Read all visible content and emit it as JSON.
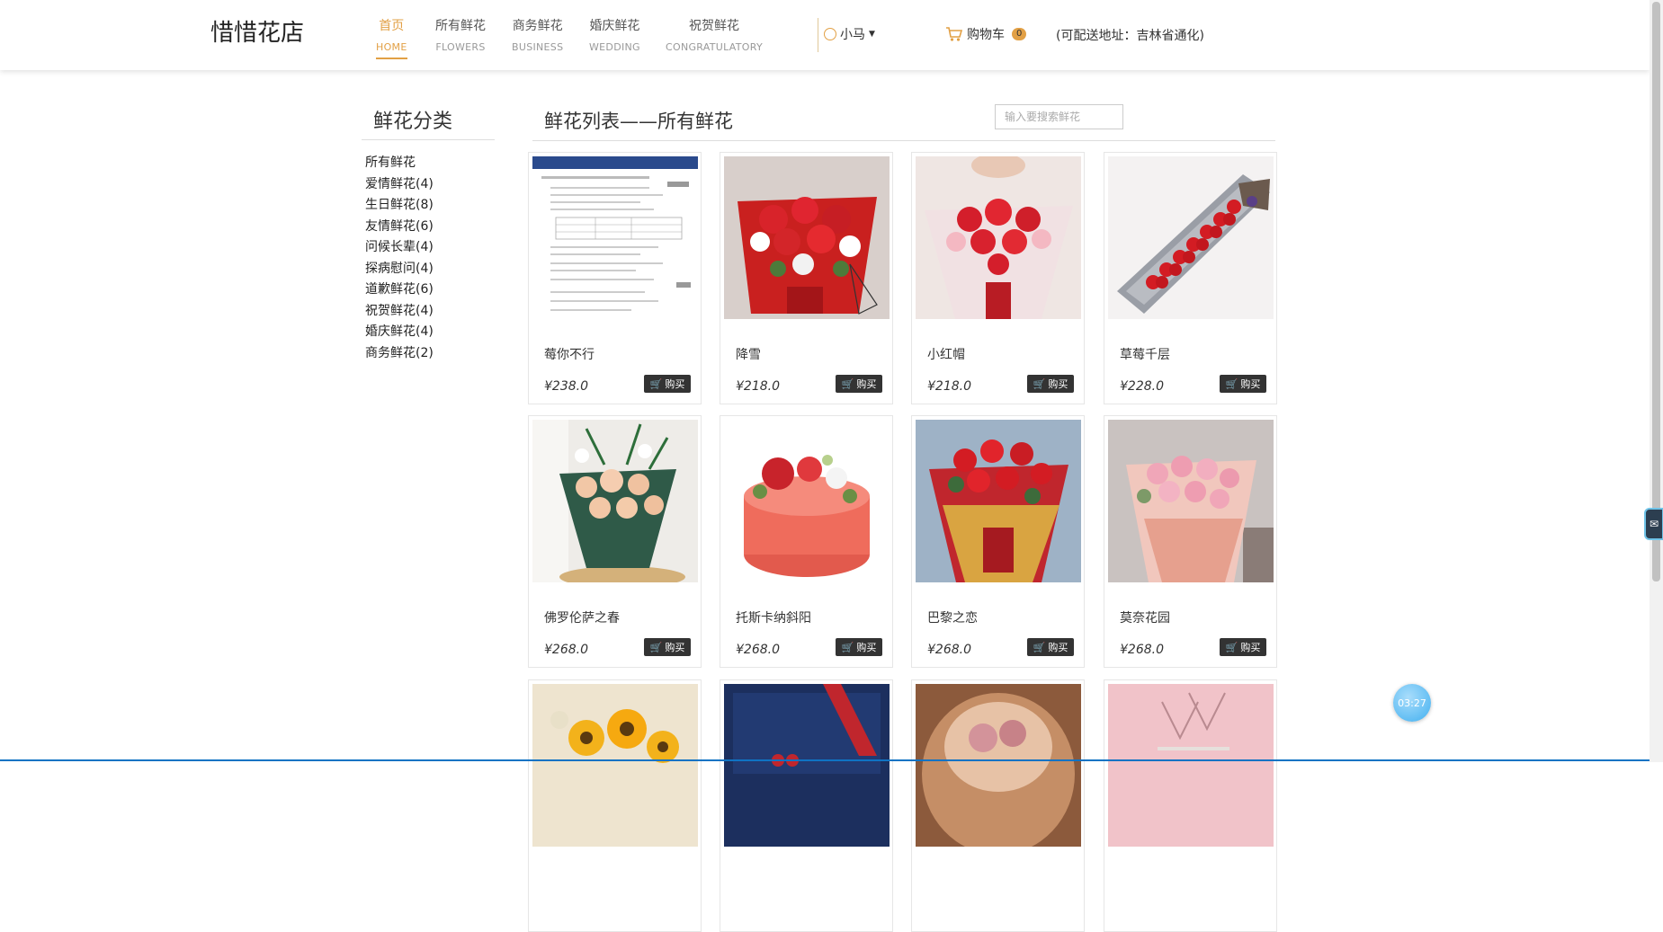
{
  "header": {
    "logo": "惜惜花店",
    "nav": [
      {
        "cn": "首页",
        "en": "HOME",
        "active": true
      },
      {
        "cn": "所有鲜花",
        "en": "FLOWERS",
        "active": false
      },
      {
        "cn": "商务鲜花",
        "en": "BUSINESS",
        "active": false
      },
      {
        "cn": "婚庆鲜花",
        "en": "WEDDING",
        "active": false
      },
      {
        "cn": "祝贺鲜花",
        "en": "CONGRATULATORY",
        "active": false
      }
    ],
    "user": "小马",
    "cart_label": "购物车",
    "cart_count": "0",
    "address": "(可配送地址：吉林省通化)"
  },
  "sidebar": {
    "title": "鲜花分类",
    "categories": [
      "所有鲜花",
      "爱情鲜花(4)",
      "生日鲜花(8)",
      "友情鲜花(6)",
      "问候长辈(4)",
      "探病慰问(4)",
      "道歉鲜花(6)",
      "祝贺鲜花(4)",
      "婚庆鲜花(4)",
      "商务鲜花(2)"
    ]
  },
  "main": {
    "title": "鲜花列表——所有鲜花",
    "search_placeholder": "输入要搜索鲜花",
    "buy_label": "购买",
    "products": [
      {
        "name": "莓你不行",
        "price": "¥238.0",
        "image": "document-screenshot"
      },
      {
        "name": "降雪",
        "price": "¥218.0",
        "image": "red-white-rose-bouquet"
      },
      {
        "name": "小红帽",
        "price": "¥218.0",
        "image": "red-rose-pink-lily-bouquet"
      },
      {
        "name": "草莓千层",
        "price": "¥228.0",
        "image": "rose-gift-box"
      },
      {
        "name": "佛罗伦萨之春",
        "price": "¥268.0",
        "image": "champagne-rose-lily-bouquet"
      },
      {
        "name": "托斯卡纳斜阳",
        "price": "¥268.0",
        "image": "flower-cake"
      },
      {
        "name": "巴黎之恋",
        "price": "¥268.0",
        "image": "red-rose-gold-wrap-bouquet"
      },
      {
        "name": "莫奈花园",
        "price": "¥268.0",
        "image": "pink-carnation-bouquet"
      },
      {
        "name": "",
        "price": "",
        "image": "sunflower-bouquet"
      },
      {
        "name": "",
        "price": "",
        "image": "navy-gift-box"
      },
      {
        "name": "",
        "price": "",
        "image": "preserved-flower-dome"
      },
      {
        "name": "",
        "price": "",
        "image": "pink-arrangement"
      }
    ]
  },
  "widgets": {
    "timer": "03:27"
  }
}
